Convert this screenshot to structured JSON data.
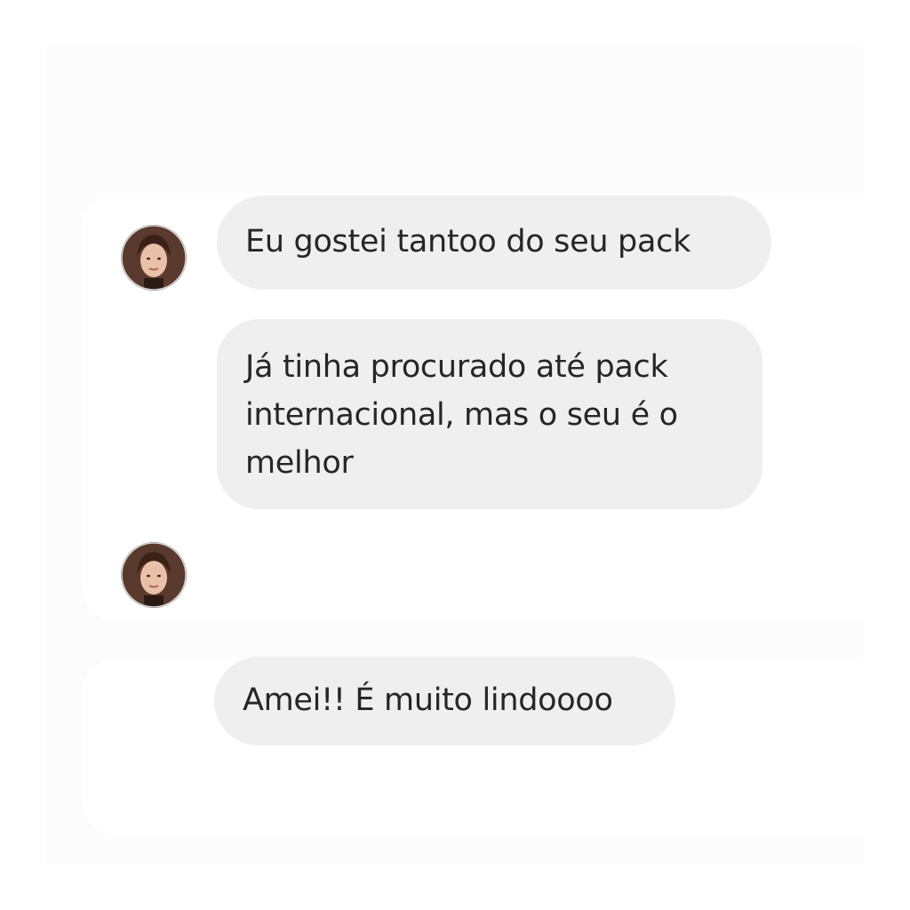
{
  "conversation": {
    "messages": [
      {
        "text": "Eu gostei tantoo do seu pack"
      },
      {
        "text": "Já tinha procurado até pack internacional, mas o seu é o melhor"
      },
      {
        "text": "Amei!! É muito lindoooo"
      }
    ]
  },
  "colors": {
    "bubble_bg": "#efefef",
    "text": "#262626",
    "background": "#fcfcfc"
  },
  "icons": {
    "avatar": "profile-photo-icon"
  }
}
